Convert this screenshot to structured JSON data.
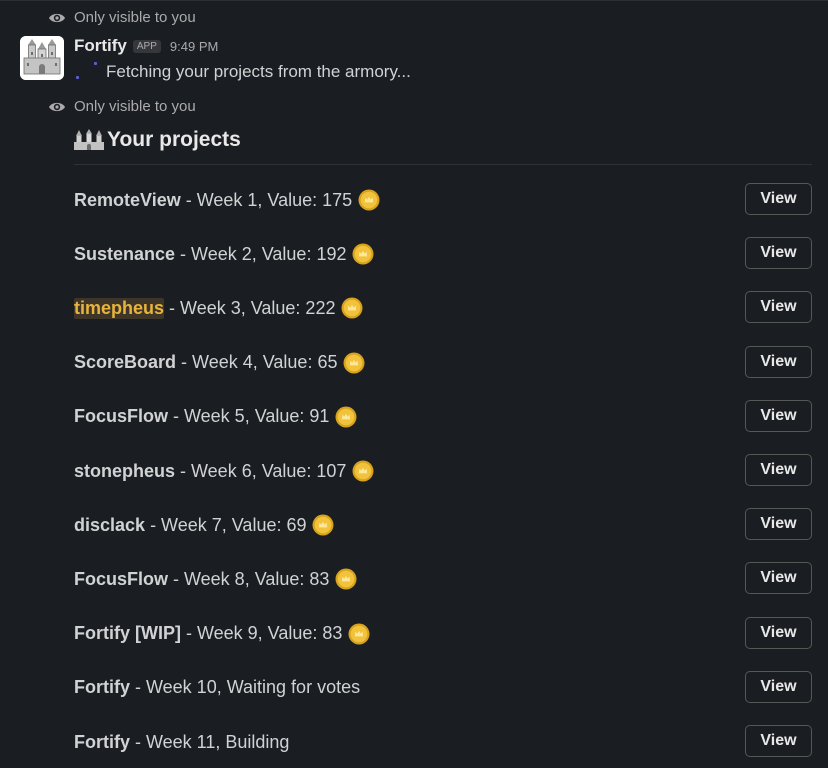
{
  "ephemeral_notes": [
    "Only visible to you",
    "Only visible to you"
  ],
  "message": {
    "app_name": "Fortify",
    "app_badge": "APP",
    "timestamp": "9:49 PM",
    "loading_text": "Fetching your projects from the armory..."
  },
  "projects_header": {
    "title": "Your projects",
    "icon": "castle-icon"
  },
  "colors": {
    "background": "#1a1d21",
    "coin": "#e8b43d",
    "highlight_text": "#e8b43d",
    "spinner": "#5b5fd6"
  },
  "projects": [
    {
      "name": "RemoteView",
      "details": " - Week 1, Value: 175",
      "coin": true,
      "highlight": false,
      "action": "View"
    },
    {
      "name": "Sustenance",
      "details": " - Week 2, Value: 192",
      "coin": true,
      "highlight": false,
      "action": "View"
    },
    {
      "name": "timepheus",
      "details": " - Week 3, Value: 222",
      "coin": true,
      "highlight": true,
      "action": "View"
    },
    {
      "name": "ScoreBoard",
      "details": " - Week 4, Value: 65",
      "coin": true,
      "highlight": false,
      "action": "View"
    },
    {
      "name": "FocusFlow",
      "details": " - Week 5, Value: 91",
      "coin": true,
      "highlight": false,
      "action": "View"
    },
    {
      "name": "stonepheus",
      "details": " - Week 6, Value: 107",
      "coin": true,
      "highlight": false,
      "action": "View"
    },
    {
      "name": "disclack",
      "details": " - Week 7, Value: 69",
      "coin": true,
      "highlight": false,
      "action": "View"
    },
    {
      "name": "FocusFlow",
      "details": " - Week 8, Value: 83",
      "coin": true,
      "highlight": false,
      "action": "View"
    },
    {
      "name": "Fortify [WIP]",
      "details": " - Week 9, Value: 83",
      "coin": true,
      "highlight": false,
      "action": "View"
    },
    {
      "name": "Fortify",
      "details": " - Week 10, Waiting for votes",
      "coin": false,
      "highlight": false,
      "action": "View"
    },
    {
      "name": "Fortify",
      "details": " - Week 11, Building",
      "coin": false,
      "highlight": false,
      "action": "View"
    }
  ]
}
